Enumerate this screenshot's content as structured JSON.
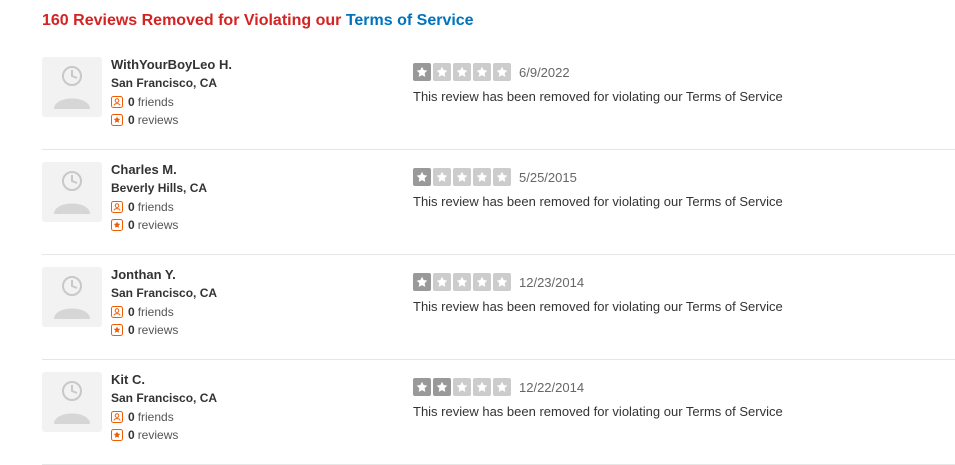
{
  "heading": {
    "prefix": "160 Reviews Removed for Violating our",
    "link": "Terms of Service"
  },
  "colors": {
    "heading_red": "#d32323",
    "link_blue": "#0073bb",
    "icon_orange": "#f15c00",
    "star_filled": "#999999",
    "star_empty": "#cccccc"
  },
  "reviews": [
    {
      "name": "WithYourBoyLeo H.",
      "location": "San Francisco, CA",
      "friends_count": "0",
      "friends_label": "friends",
      "reviews_count": "0",
      "reviews_label": "reviews",
      "rating": 1,
      "date": "6/9/2022",
      "text": "This review has been removed for violating our Terms of Service"
    },
    {
      "name": "Charles M.",
      "location": "Beverly Hills, CA",
      "friends_count": "0",
      "friends_label": "friends",
      "reviews_count": "0",
      "reviews_label": "reviews",
      "rating": 1,
      "date": "5/25/2015",
      "text": "This review has been removed for violating our Terms of Service"
    },
    {
      "name": "Jonthan Y.",
      "location": "San Francisco, CA",
      "friends_count": "0",
      "friends_label": "friends",
      "reviews_count": "0",
      "reviews_label": "reviews",
      "rating": 1,
      "date": "12/23/2014",
      "text": "This review has been removed for violating our Terms of Service"
    },
    {
      "name": "Kit C.",
      "location": "San Francisco, CA",
      "friends_count": "0",
      "friends_label": "friends",
      "reviews_count": "0",
      "reviews_label": "reviews",
      "rating": 2,
      "date": "12/22/2014",
      "text": "This review has been removed for violating our Terms of Service"
    }
  ]
}
